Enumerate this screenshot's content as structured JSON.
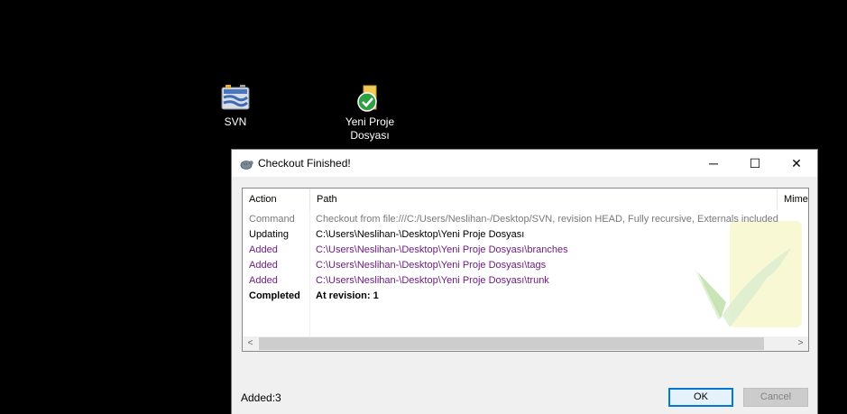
{
  "desktop": {
    "icons": [
      {
        "label": "SVN"
      },
      {
        "label_line1": "Yeni Proje",
        "label_line2": "Dosyası"
      }
    ]
  },
  "dialog": {
    "title": "Checkout Finished!",
    "window_buttons": {
      "minimize": "─",
      "maximize": "☐",
      "close": "✕"
    },
    "columns": [
      "Action",
      "Path",
      "Mime t"
    ],
    "rows": [
      {
        "action": "Command",
        "path": "Checkout from file:///C:/Users/Neslihan-/Desktop/SVN, revision HEAD, Fully recursive, Externals included"
      },
      {
        "action": "Updating",
        "path": "C:\\Users\\Neslihan-\\Desktop\\Yeni Proje Dosyası"
      },
      {
        "action": "Added",
        "path": "C:\\Users\\Neslihan-\\Desktop\\Yeni Proje Dosyası\\branches"
      },
      {
        "action": "Added",
        "path": "C:\\Users\\Neslihan-\\Desktop\\Yeni Proje Dosyası\\tags"
      },
      {
        "action": "Added",
        "path": "C:\\Users\\Neslihan-\\Desktop\\Yeni Proje Dosyası\\trunk"
      },
      {
        "action": "Completed",
        "path": "At revision: 1"
      }
    ],
    "scroll": {
      "left": "<",
      "right": ">"
    },
    "status": "Added:3",
    "buttons": {
      "ok": "OK",
      "cancel": "Cancel"
    },
    "colors": {
      "added": "#6c1b7c",
      "command": "#7a7a7a",
      "ok_border": "#0078d7"
    }
  }
}
